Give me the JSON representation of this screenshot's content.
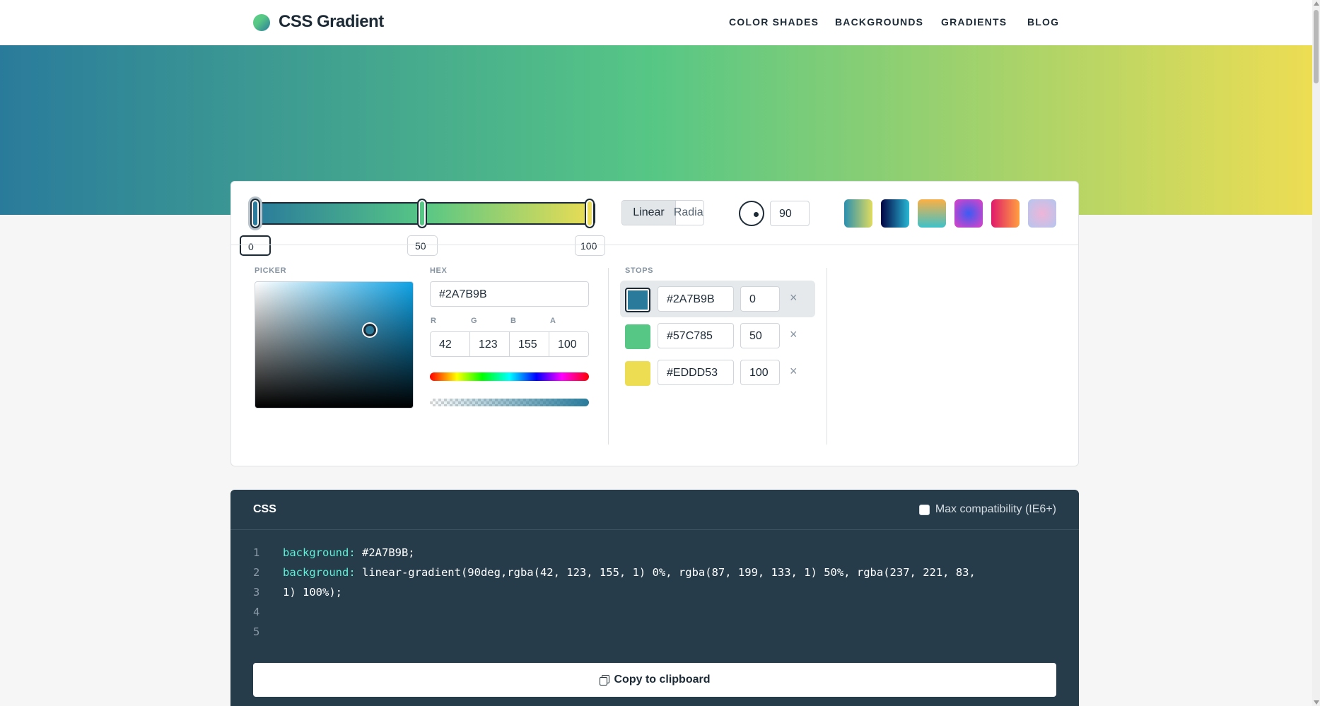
{
  "header": {
    "brand": "CSS Gradient",
    "nav": [
      "COLOR SHADES",
      "BACKGROUNDS",
      "GRADIENTS",
      "BLOG"
    ]
  },
  "gradient": {
    "colors": [
      "#2A7B9B",
      "#57C785",
      "#EDDD53"
    ],
    "stop_positions": [
      "0",
      "50",
      "100"
    ],
    "type_options": [
      "Linear",
      "Radial"
    ],
    "selected_type": "Linear",
    "angle": "90",
    "presets": [
      {
        "name": "preset-1",
        "from": "#2a8fb0",
        "to": "#e0dc5f"
      },
      {
        "name": "preset-2",
        "from": "#020344",
        "to": "#28b8d5"
      },
      {
        "name": "preset-3",
        "from": "#fcb045",
        "to": "#3ec1c9"
      },
      {
        "name": "preset-4",
        "from": "#e242c4",
        "to": "#3b5bf3"
      },
      {
        "name": "preset-5",
        "from": "#ffa040",
        "to": "#e01a6b"
      },
      {
        "name": "preset-6",
        "from": "#d7b3e6",
        "to": "#b4c6ef"
      }
    ]
  },
  "picker": {
    "label": "PICKER",
    "hex_label": "HEX",
    "hex": "#2A7B9B",
    "rgba_labels": [
      "R",
      "G",
      "B",
      "A"
    ],
    "rgba": [
      "42",
      "123",
      "155",
      "100"
    ]
  },
  "stops": {
    "label": "STOPS",
    "items": [
      {
        "hex": "#2A7B9B",
        "pos": "0",
        "color": "#2a7b9b"
      },
      {
        "hex": "#57C785",
        "pos": "50",
        "color": "#57c785"
      },
      {
        "hex": "#EDDD53",
        "pos": "100",
        "color": "#eddd53"
      }
    ],
    "remove_glyph": "×"
  },
  "css": {
    "title": "CSS",
    "compat_label": "Max compatibility (IE6+)",
    "line_numbers": [
      "1",
      "2",
      "3",
      "4",
      "5"
    ],
    "prop": "background:",
    "line1_value": " #2A7B9B;",
    "line2_value": " linear-gradient(90deg,rgba(42, 123, 155, 1) 0%, rgba(87, 199, 133, 1) 50%, rgba(237, 221, 83,",
    "line3": "1) 100%);",
    "copy_label": "Copy to clipboard"
  }
}
